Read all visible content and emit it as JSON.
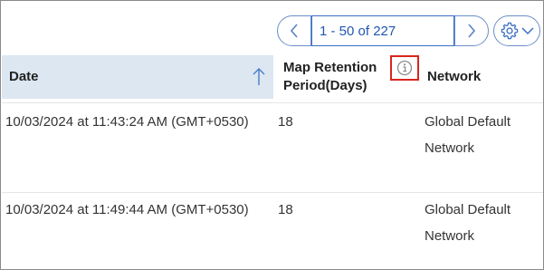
{
  "pager": {
    "range_text": "1 - 50 of 227",
    "prev_icon": "chevron-left-icon",
    "next_icon": "chevron-right-icon"
  },
  "settings": {
    "icon": "gear-icon",
    "dropdown_icon": "chevron-down-icon"
  },
  "table": {
    "columns": [
      {
        "label": "Date",
        "sort": "ascending"
      },
      {
        "label": "Map Retention Period(Days)",
        "info_icon": "info-icon"
      },
      {
        "label": "Network"
      }
    ],
    "rows": [
      {
        "date": "10/03/2024 at 11:43:24 AM (GMT+0530)",
        "retention": "18",
        "network": "Global Default Network"
      },
      {
        "date": "10/03/2024 at 11:49:44 AM (GMT+0530)",
        "retention": "18",
        "network": "Global Default Network"
      }
    ]
  },
  "colors": {
    "header_bg": "#dce7f2",
    "accent": "#1f57b0",
    "highlight_border": "#d9261c"
  }
}
